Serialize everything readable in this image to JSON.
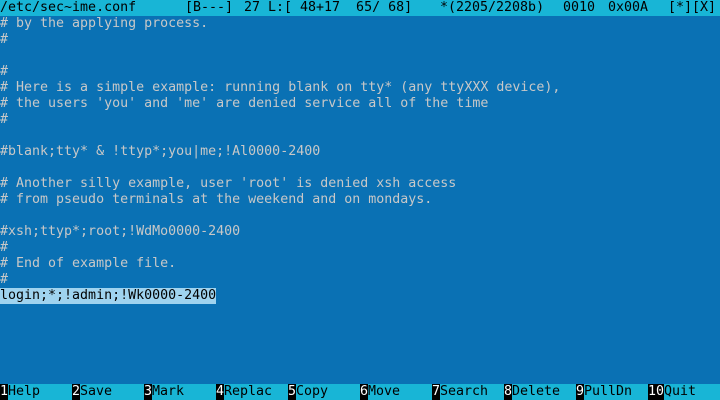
{
  "status_bar": {
    "filename": "/etc/sec~ime.conf",
    "mode": "[B---]",
    "column": "27",
    "line_info": "L:[ 48+17  65/ 68]",
    "offset": "*(2205/2208b)",
    "char_code": "0010",
    "char_hex": "0x00A",
    "flags": "[*][X]"
  },
  "editor": {
    "lines": [
      "# by the applying process.",
      "#",
      "",
      "#",
      "# Here is a simple example: running blank on tty* (any ttyXXX device),",
      "# the users 'you' and 'me' are denied service all of the time",
      "#",
      "",
      "#blank;tty* & !ttyp*;you|me;!Al0000-2400",
      "",
      "# Another silly example, user 'root' is denied xsh access",
      "# from pseudo terminals at the weekend and on mondays.",
      "",
      "#xsh;ttyp*;root;!WdMo0000-2400",
      "#",
      "# End of example file.",
      "#",
      "login;*;!admin;!Wk0000-2400"
    ],
    "current_line_index": 17
  },
  "function_keys": [
    {
      "num": "1",
      "label": "Help"
    },
    {
      "num": "2",
      "label": "Save"
    },
    {
      "num": "3",
      "label": "Mark"
    },
    {
      "num": "4",
      "label": "Replac"
    },
    {
      "num": "5",
      "label": "Copy"
    },
    {
      "num": "6",
      "label": "Move"
    },
    {
      "num": "7",
      "label": "Search"
    },
    {
      "num": "8",
      "label": "Delete"
    },
    {
      "num": "9",
      "label": "PullDn"
    },
    {
      "num": "10",
      "label": "Quit"
    }
  ],
  "colors": {
    "background": "#0a71b4",
    "status_bar": "#18b5d6",
    "text": "#c8c8c8",
    "current_line": "#9fd3ef"
  }
}
